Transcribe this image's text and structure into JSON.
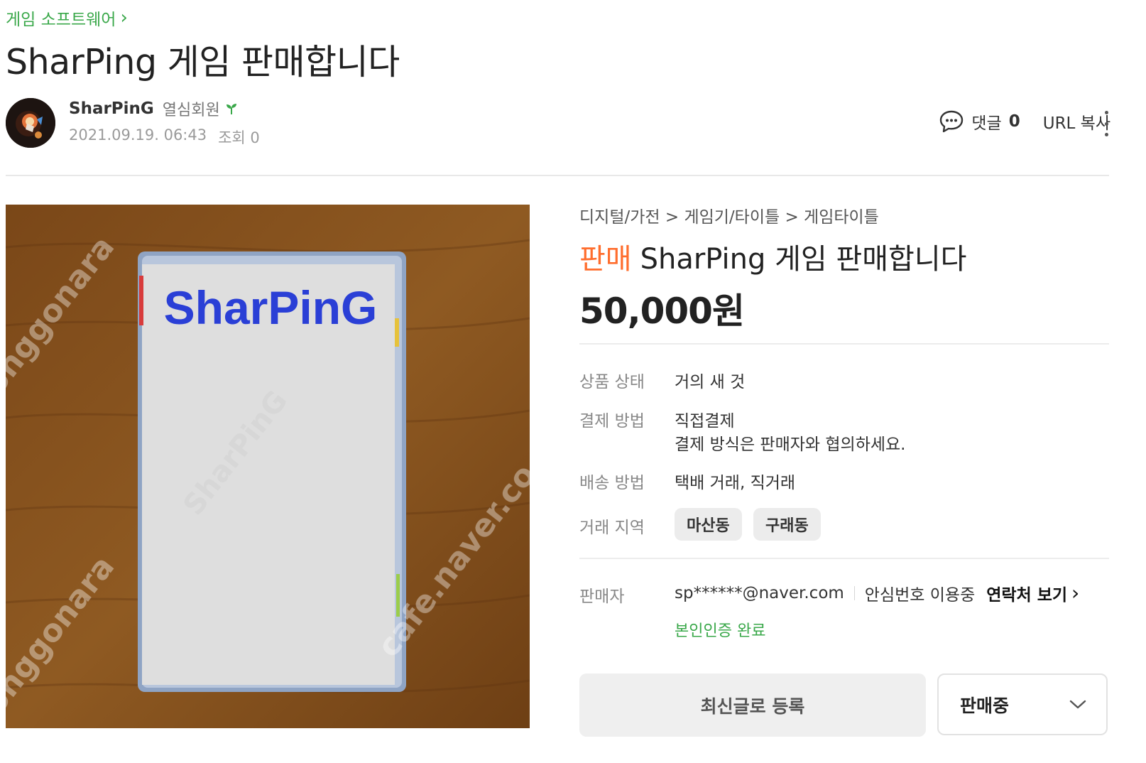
{
  "breadcrumb": {
    "label": "게임 소프트웨어",
    "chevron": "›"
  },
  "post": {
    "title": "SharPing 게임 판매합니다",
    "author": {
      "name": "SharPinG",
      "grade": "열심회원",
      "grade_icon": "sprout-icon"
    },
    "date": "2021.09.19. 06:43",
    "views_label": "조회 0"
  },
  "actions": {
    "comment_label": "댓글",
    "comment_count": "0",
    "url_copy_label": "URL 복사",
    "more_icon": "more-vertical-icon"
  },
  "photo": {
    "box_text": "SharPinG",
    "watermarks": [
      "onggonara",
      "SharPinG",
      "cafe.naver.co",
      "onggonara"
    ]
  },
  "product": {
    "category": "디지털/가전 > 게임기/타이틀 > 게임타이틀",
    "sale_badge": "판매",
    "title": "SharPing 게임 판매합니다",
    "price": "50,000원",
    "details": {
      "condition_label": "상품 상태",
      "condition_value": "거의 새 것",
      "payment_label": "결제 방법",
      "payment_value": "직접결제",
      "payment_note": "결제 방식은 판매자와 협의하세요.",
      "shipping_label": "배송 방법",
      "shipping_value": "택배 거래, 직거래",
      "region_label": "거래 지역",
      "regions": [
        "마산동",
        "구래동"
      ]
    },
    "seller": {
      "label": "판매자",
      "email": "sp******@naver.com",
      "safe_number": "안심번호 이용중",
      "contact_label": "연락처 보기",
      "contact_chevron": "›",
      "verified": "본인인증 완료"
    },
    "buttons": {
      "refresh_label": "최신글로 등록",
      "status_selected": "판매중"
    }
  },
  "colors": {
    "green": "#3aa84a",
    "orange": "#ff6d2d",
    "wood": "#8a5520",
    "title_blue": "#2a3fd6"
  }
}
